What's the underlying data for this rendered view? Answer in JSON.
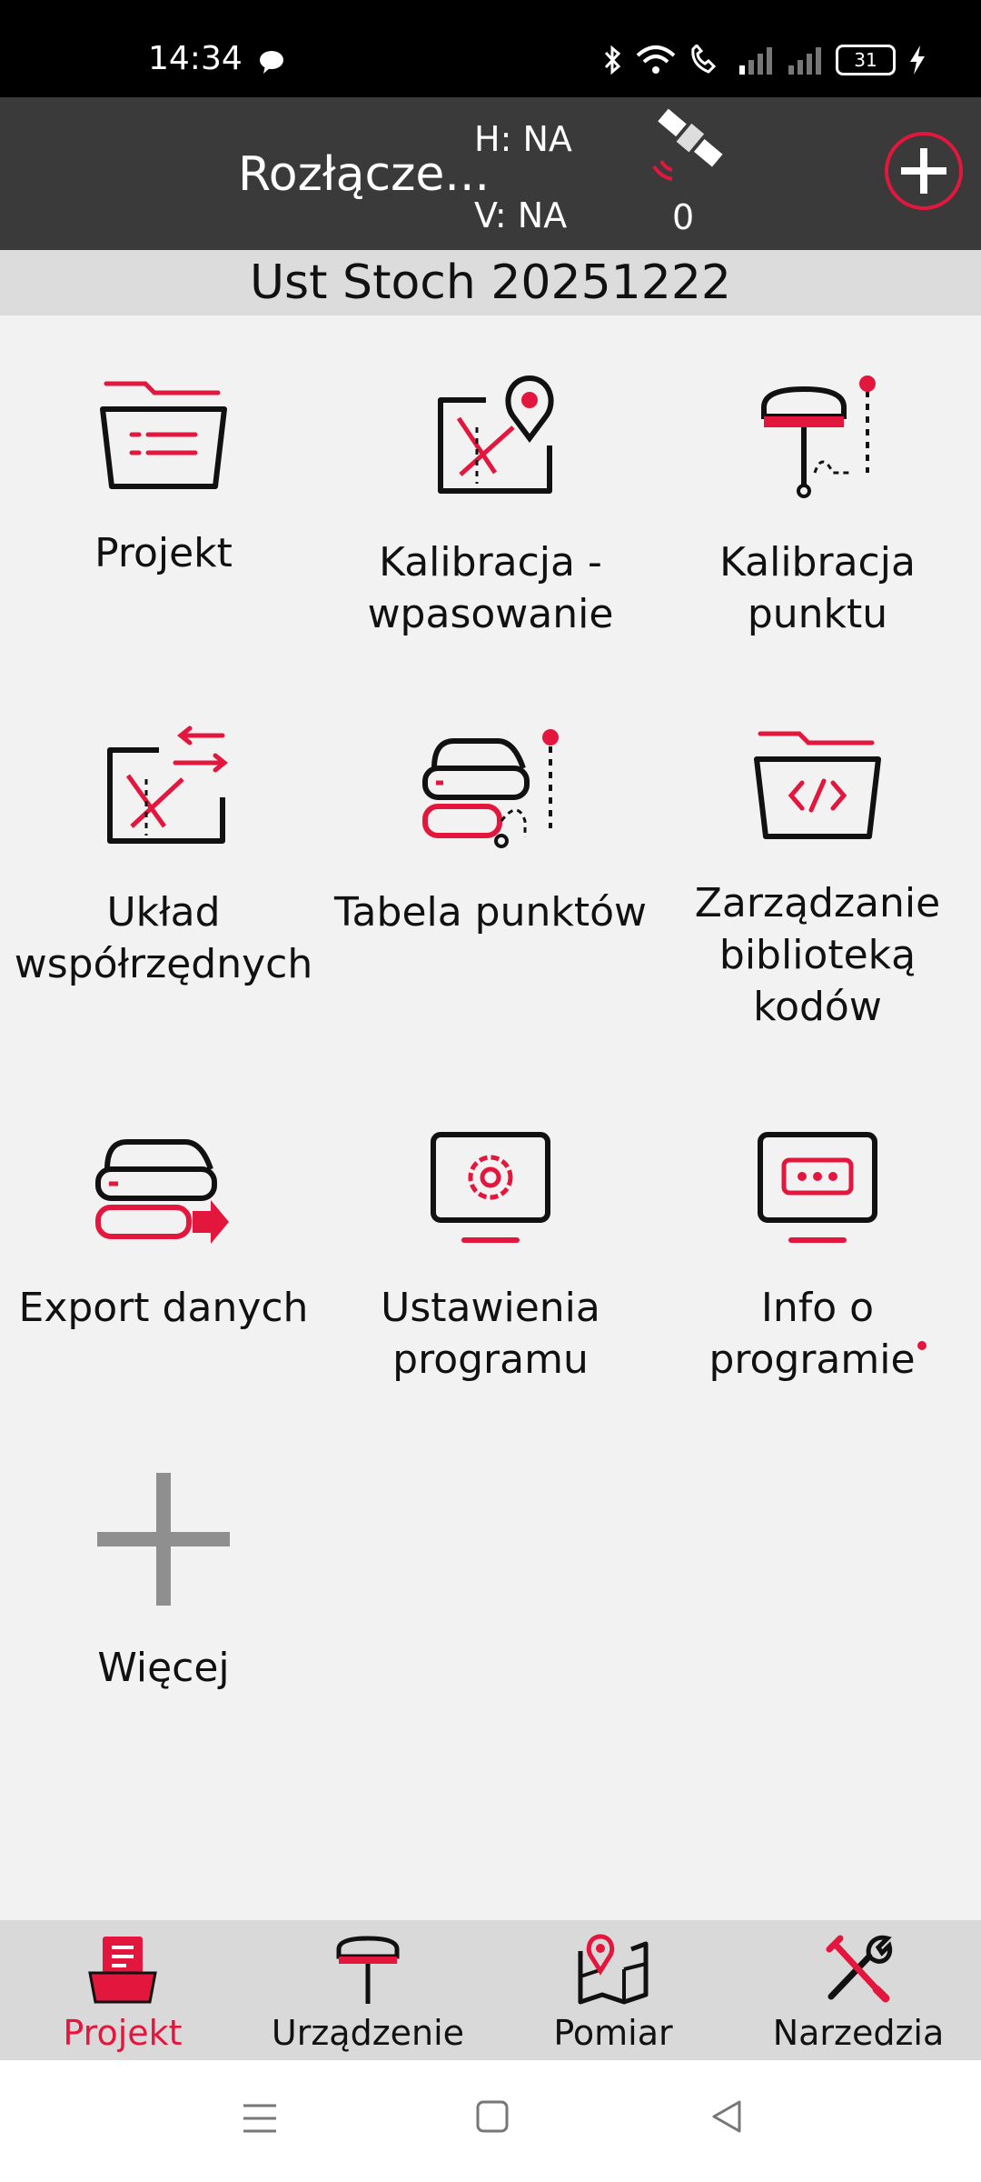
{
  "status_bar": {
    "time": "14:34",
    "battery": "31"
  },
  "top_bar": {
    "connection": "Rozłącze...",
    "h_label": "H: NA",
    "v_label": "V: NA",
    "satellite_count": "0"
  },
  "project": {
    "name": "Ust Stoch 20251222"
  },
  "tiles": [
    {
      "label": "Projekt"
    },
    {
      "label": "Kalibracja - wpasowanie"
    },
    {
      "label": "Kalibracja punktu"
    },
    {
      "label": "Układ współrzędnych"
    },
    {
      "label": "Tabela punktów"
    },
    {
      "label": "Zarządzanie biblioteką kodów"
    },
    {
      "label": "Export danych"
    },
    {
      "label": "Ustawienia programu"
    },
    {
      "label": "Info o programie"
    },
    {
      "label": "Więcej"
    }
  ],
  "bottom_nav": [
    {
      "label": "Projekt",
      "active": true
    },
    {
      "label": "Urządzenie"
    },
    {
      "label": "Pomiar"
    },
    {
      "label": "Narzedzia"
    }
  ],
  "colors": {
    "accent": "#e3173e",
    "header": "#3a3a3a",
    "background": "#f2f2f2"
  }
}
